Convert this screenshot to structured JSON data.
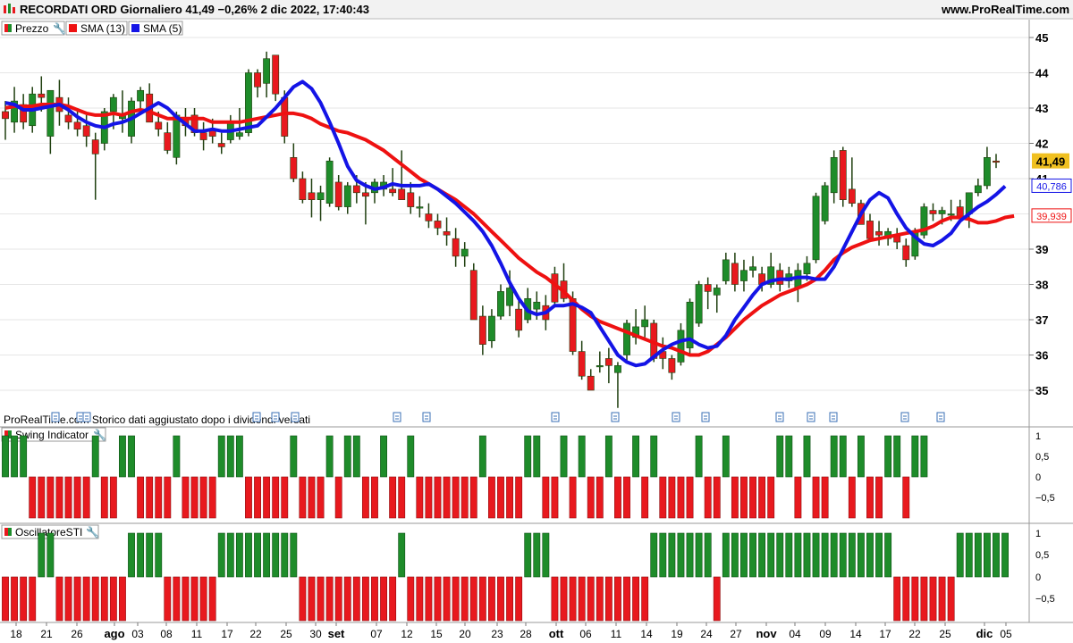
{
  "header": {
    "title": "RECORDATI ORD Giornaliero 41,49 −0,26% 2 dic 2022, 17:40:43",
    "brand": "www.ProRealTime.com"
  },
  "legend": {
    "price": "Prezzo",
    "sma13": "SMA (13)",
    "sma5": "SMA (5)"
  },
  "panels": {
    "swing_title": "Swing Indicator",
    "sti_title": "OscillatoreSTI"
  },
  "note": "ProRealTime.com  Storico dati aggiustato dopo i dividendi versati",
  "colors": {
    "up": "#1e8c2a",
    "down": "#e8191e",
    "sma13": "#ee1111",
    "sma5": "#1414e6",
    "wick": "#1f3f0f",
    "last_price_bg": "#f0c020"
  },
  "price_axis": {
    "ticks": [
      "45",
      "44",
      "43",
      "42",
      "41",
      "39",
      "38",
      "37",
      "36",
      "35"
    ],
    "last_price": "41,49",
    "sma5_value": "40,786",
    "sma13_value": "39,939"
  },
  "swing_axis": {
    "ticks": [
      "1",
      "0,5",
      "0",
      "−0,5"
    ]
  },
  "sti_axis": {
    "ticks": [
      "1",
      "0,5",
      "0",
      "−0,5"
    ]
  },
  "x_axis": {
    "labels": [
      "18",
      "21",
      "26",
      "ago",
      "03",
      "08",
      "11",
      "17",
      "22",
      "25",
      "30",
      "set",
      "07",
      "12",
      "15",
      "20",
      "23",
      "28",
      "ott",
      "06",
      "11",
      "14",
      "19",
      "24",
      "27",
      "nov",
      "04",
      "09",
      "14",
      "17",
      "22",
      "25",
      "dic",
      "05"
    ]
  },
  "chart_data": {
    "type": "candlestick",
    "ylim": [
      34.7,
      45.1
    ],
    "candles": [
      {
        "o": 42.9,
        "h": 43.2,
        "l": 42.1,
        "c": 42.7
      },
      {
        "o": 42.6,
        "h": 43.6,
        "l": 42.3,
        "c": 43.2
      },
      {
        "o": 43.1,
        "h": 43.4,
        "l": 42.4,
        "c": 42.6
      },
      {
        "o": 42.5,
        "h": 43.6,
        "l": 42.3,
        "c": 43.4
      },
      {
        "o": 43.4,
        "h": 43.9,
        "l": 42.9,
        "c": 43.3
      },
      {
        "o": 42.2,
        "h": 43.5,
        "l": 41.7,
        "c": 43.5
      },
      {
        "o": 43.3,
        "h": 43.8,
        "l": 42.5,
        "c": 42.9
      },
      {
        "o": 42.8,
        "h": 43.3,
        "l": 42.4,
        "c": 42.6
      },
      {
        "o": 42.6,
        "h": 42.9,
        "l": 42.2,
        "c": 42.4
      },
      {
        "o": 42.5,
        "h": 42.8,
        "l": 41.9,
        "c": 42.2
      },
      {
        "o": 42.1,
        "h": 42.3,
        "l": 40.4,
        "c": 41.7
      },
      {
        "o": 42.0,
        "h": 43.0,
        "l": 41.8,
        "c": 42.9
      },
      {
        "o": 42.9,
        "h": 43.4,
        "l": 42.4,
        "c": 43.3
      },
      {
        "o": 42.7,
        "h": 43.5,
        "l": 42.3,
        "c": 42.8
      },
      {
        "o": 42.2,
        "h": 43.3,
        "l": 42.0,
        "c": 43.2
      },
      {
        "o": 43.2,
        "h": 43.6,
        "l": 42.8,
        "c": 43.5
      },
      {
        "o": 43.4,
        "h": 43.7,
        "l": 42.6,
        "c": 42.6
      },
      {
        "o": 42.6,
        "h": 42.9,
        "l": 42.2,
        "c": 42.4
      },
      {
        "o": 42.3,
        "h": 42.6,
        "l": 41.7,
        "c": 41.8
      },
      {
        "o": 41.6,
        "h": 42.9,
        "l": 41.4,
        "c": 42.8
      },
      {
        "o": 42.7,
        "h": 43.0,
        "l": 42.2,
        "c": 42.5
      },
      {
        "o": 42.8,
        "h": 43.0,
        "l": 42.2,
        "c": 42.3
      },
      {
        "o": 42.3,
        "h": 42.6,
        "l": 41.8,
        "c": 42.1
      },
      {
        "o": 42.4,
        "h": 42.7,
        "l": 42.0,
        "c": 42.2
      },
      {
        "o": 42.0,
        "h": 42.3,
        "l": 41.7,
        "c": 41.9
      },
      {
        "o": 42.1,
        "h": 42.8,
        "l": 42.0,
        "c": 42.6
      },
      {
        "o": 42.2,
        "h": 43.0,
        "l": 42.1,
        "c": 42.3
      },
      {
        "o": 42.3,
        "h": 44.1,
        "l": 42.2,
        "c": 44.0
      },
      {
        "o": 44.0,
        "h": 44.1,
        "l": 43.3,
        "c": 43.6
      },
      {
        "o": 43.7,
        "h": 44.6,
        "l": 43.3,
        "c": 44.4
      },
      {
        "o": 44.5,
        "h": 44.5,
        "l": 43.2,
        "c": 43.4
      },
      {
        "o": 43.3,
        "h": 43.5,
        "l": 42.0,
        "c": 42.2
      },
      {
        "o": 41.6,
        "h": 42.0,
        "l": 40.9,
        "c": 41.0
      },
      {
        "o": 41.0,
        "h": 41.2,
        "l": 40.3,
        "c": 40.4
      },
      {
        "o": 40.6,
        "h": 41.0,
        "l": 39.9,
        "c": 40.4
      },
      {
        "o": 40.4,
        "h": 40.8,
        "l": 39.8,
        "c": 40.6
      },
      {
        "o": 40.3,
        "h": 41.6,
        "l": 40.2,
        "c": 41.5
      },
      {
        "o": 40.9,
        "h": 41.1,
        "l": 40.1,
        "c": 40.2
      },
      {
        "o": 40.2,
        "h": 40.9,
        "l": 40.0,
        "c": 40.8
      },
      {
        "o": 40.8,
        "h": 41.1,
        "l": 40.3,
        "c": 40.6
      },
      {
        "o": 40.6,
        "h": 40.9,
        "l": 39.7,
        "c": 40.5
      },
      {
        "o": 40.6,
        "h": 41.0,
        "l": 40.3,
        "c": 40.9
      },
      {
        "o": 40.7,
        "h": 41.1,
        "l": 40.5,
        "c": 40.9
      },
      {
        "o": 40.7,
        "h": 41.3,
        "l": 40.5,
        "c": 40.6
      },
      {
        "o": 40.7,
        "h": 41.8,
        "l": 40.4,
        "c": 40.4
      },
      {
        "o": 40.6,
        "h": 40.9,
        "l": 40.0,
        "c": 40.2
      },
      {
        "o": 40.2,
        "h": 40.5,
        "l": 39.9,
        "c": 40.2
      },
      {
        "o": 40.0,
        "h": 40.3,
        "l": 39.6,
        "c": 39.8
      },
      {
        "o": 39.8,
        "h": 40.0,
        "l": 39.4,
        "c": 39.6
      },
      {
        "o": 39.5,
        "h": 39.9,
        "l": 39.1,
        "c": 39.4
      },
      {
        "o": 39.3,
        "h": 39.6,
        "l": 38.5,
        "c": 38.8
      },
      {
        "o": 38.8,
        "h": 39.2,
        "l": 38.5,
        "c": 39.0
      },
      {
        "o": 38.4,
        "h": 38.6,
        "l": 37.0,
        "c": 37.0
      },
      {
        "o": 37.1,
        "h": 37.4,
        "l": 36.0,
        "c": 36.3
      },
      {
        "o": 36.4,
        "h": 37.3,
        "l": 36.2,
        "c": 37.1
      },
      {
        "o": 37.1,
        "h": 38.0,
        "l": 37.0,
        "c": 37.8
      },
      {
        "o": 37.4,
        "h": 38.4,
        "l": 37.1,
        "c": 37.9
      },
      {
        "o": 37.3,
        "h": 37.6,
        "l": 36.5,
        "c": 36.7
      },
      {
        "o": 37.0,
        "h": 37.9,
        "l": 36.9,
        "c": 37.6
      },
      {
        "o": 37.3,
        "h": 37.8,
        "l": 37.0,
        "c": 37.5
      },
      {
        "o": 37.4,
        "h": 37.7,
        "l": 36.7,
        "c": 37.0
      },
      {
        "o": 38.3,
        "h": 38.5,
        "l": 37.4,
        "c": 37.5
      },
      {
        "o": 38.1,
        "h": 38.6,
        "l": 37.5,
        "c": 37.6
      },
      {
        "o": 37.6,
        "h": 37.8,
        "l": 36.0,
        "c": 36.1
      },
      {
        "o": 36.1,
        "h": 36.4,
        "l": 35.3,
        "c": 35.4
      },
      {
        "o": 35.4,
        "h": 35.6,
        "l": 35.1,
        "c": 35.0
      },
      {
        "o": 35.7,
        "h": 36.1,
        "l": 35.5,
        "c": 35.7
      },
      {
        "o": 35.9,
        "h": 36.2,
        "l": 35.2,
        "c": 35.7
      },
      {
        "o": 35.5,
        "h": 35.8,
        "l": 34.5,
        "c": 35.7
      },
      {
        "o": 36.0,
        "h": 37.0,
        "l": 35.8,
        "c": 36.9
      },
      {
        "o": 36.5,
        "h": 37.3,
        "l": 36.3,
        "c": 36.8
      },
      {
        "o": 36.8,
        "h": 37.4,
        "l": 36.5,
        "c": 37.0
      },
      {
        "o": 36.9,
        "h": 37.0,
        "l": 35.8,
        "c": 35.9
      },
      {
        "o": 36.1,
        "h": 36.5,
        "l": 35.6,
        "c": 35.9
      },
      {
        "o": 35.9,
        "h": 36.0,
        "l": 35.3,
        "c": 35.5
      },
      {
        "o": 35.8,
        "h": 36.9,
        "l": 35.7,
        "c": 36.7
      },
      {
        "o": 36.2,
        "h": 37.6,
        "l": 36.0,
        "c": 37.5
      },
      {
        "o": 36.9,
        "h": 38.1,
        "l": 36.8,
        "c": 38.0
      },
      {
        "o": 38.0,
        "h": 38.2,
        "l": 37.3,
        "c": 37.8
      },
      {
        "o": 37.7,
        "h": 38.0,
        "l": 37.2,
        "c": 37.9
      },
      {
        "o": 38.1,
        "h": 38.9,
        "l": 38.0,
        "c": 38.7
      },
      {
        "o": 38.6,
        "h": 38.9,
        "l": 37.8,
        "c": 38.0
      },
      {
        "o": 38.1,
        "h": 38.7,
        "l": 37.8,
        "c": 38.4
      },
      {
        "o": 38.4,
        "h": 38.8,
        "l": 38.2,
        "c": 38.5
      },
      {
        "o": 38.3,
        "h": 38.5,
        "l": 37.8,
        "c": 38.0
      },
      {
        "o": 38.0,
        "h": 38.9,
        "l": 37.9,
        "c": 38.5
      },
      {
        "o": 38.4,
        "h": 38.6,
        "l": 37.8,
        "c": 38.0
      },
      {
        "o": 38.1,
        "h": 38.5,
        "l": 37.9,
        "c": 38.3
      },
      {
        "o": 37.9,
        "h": 38.6,
        "l": 37.5,
        "c": 38.4
      },
      {
        "o": 38.3,
        "h": 38.8,
        "l": 38.1,
        "c": 38.6
      },
      {
        "o": 38.7,
        "h": 40.6,
        "l": 38.6,
        "c": 40.5
      },
      {
        "o": 39.8,
        "h": 40.9,
        "l": 39.7,
        "c": 40.8
      },
      {
        "o": 40.6,
        "h": 41.8,
        "l": 40.3,
        "c": 41.6
      },
      {
        "o": 41.8,
        "h": 41.9,
        "l": 40.2,
        "c": 40.4
      },
      {
        "o": 40.7,
        "h": 41.6,
        "l": 40.2,
        "c": 40.3
      },
      {
        "o": 40.3,
        "h": 40.4,
        "l": 39.7,
        "c": 39.7
      },
      {
        "o": 39.8,
        "h": 40.0,
        "l": 39.2,
        "c": 39.3
      },
      {
        "o": 39.5,
        "h": 39.8,
        "l": 39.1,
        "c": 39.4
      },
      {
        "o": 39.3,
        "h": 39.6,
        "l": 39.1,
        "c": 39.5
      },
      {
        "o": 39.4,
        "h": 39.6,
        "l": 39.0,
        "c": 39.2
      },
      {
        "o": 39.1,
        "h": 39.3,
        "l": 38.5,
        "c": 38.7
      },
      {
        "o": 38.8,
        "h": 39.6,
        "l": 38.7,
        "c": 39.5
      },
      {
        "o": 39.4,
        "h": 40.3,
        "l": 39.3,
        "c": 40.2
      },
      {
        "o": 40.1,
        "h": 40.3,
        "l": 39.8,
        "c": 40.0
      },
      {
        "o": 40.0,
        "h": 40.2,
        "l": 39.7,
        "c": 40.1
      },
      {
        "o": 40.0,
        "h": 40.4,
        "l": 39.8,
        "c": 40.0
      },
      {
        "o": 40.2,
        "h": 40.4,
        "l": 39.8,
        "c": 39.9
      },
      {
        "o": 40.0,
        "h": 40.6,
        "l": 39.6,
        "c": 40.6
      },
      {
        "o": 40.6,
        "h": 41.0,
        "l": 40.5,
        "c": 40.8
      },
      {
        "o": 40.8,
        "h": 41.9,
        "l": 40.7,
        "c": 41.6
      },
      {
        "o": 41.5,
        "h": 41.7,
        "l": 41.3,
        "c": 41.49
      }
    ],
    "sma13": [
      43.0,
      43.05,
      43.05,
      43.05,
      43.1,
      43.1,
      43.1,
      43.05,
      42.95,
      42.85,
      42.8,
      42.8,
      42.85,
      42.8,
      42.9,
      42.95,
      42.9,
      42.8,
      42.7,
      42.7,
      42.7,
      42.7,
      42.7,
      42.6,
      42.6,
      42.6,
      42.6,
      42.65,
      42.7,
      42.75,
      42.8,
      42.85,
      42.85,
      42.8,
      42.7,
      42.55,
      42.45,
      42.35,
      42.3,
      42.2,
      42.1,
      41.95,
      41.8,
      41.6,
      41.4,
      41.2,
      41.0,
      40.85,
      40.7,
      40.55,
      40.4,
      40.2,
      40.0,
      39.75,
      39.5,
      39.25,
      39.0,
      38.75,
      38.55,
      38.35,
      38.2,
      38.0,
      37.8,
      37.55,
      37.3,
      37.1,
      36.95,
      36.85,
      36.75,
      36.65,
      36.55,
      36.45,
      36.35,
      36.25,
      36.2,
      36.1,
      36.0,
      36.0,
      36.1,
      36.3,
      36.5,
      36.75,
      37.0,
      37.2,
      37.4,
      37.55,
      37.7,
      37.8,
      37.9,
      38.0,
      38.15,
      38.4,
      38.7,
      38.9,
      39.05,
      39.15,
      39.25,
      39.3,
      39.35,
      39.4,
      39.45,
      39.5,
      39.55,
      39.65,
      39.8,
      39.9,
      39.9,
      39.85,
      39.75,
      39.75,
      39.8,
      39.9,
      39.94
    ],
    "sma5": [
      43.15,
      43.1,
      42.95,
      42.95,
      43.0,
      43.05,
      43.1,
      42.95,
      42.75,
      42.6,
      42.5,
      42.45,
      42.55,
      42.6,
      42.7,
      42.85,
      43.0,
      43.15,
      43.0,
      42.75,
      42.55,
      42.35,
      42.35,
      42.4,
      42.35,
      42.35,
      42.4,
      42.45,
      42.5,
      42.75,
      43.0,
      43.3,
      43.6,
      43.75,
      43.55,
      43.15,
      42.6,
      42.0,
      41.35,
      40.95,
      40.8,
      40.7,
      40.75,
      40.85,
      40.8,
      40.8,
      40.8,
      40.85,
      40.7,
      40.5,
      40.3,
      40.05,
      39.8,
      39.5,
      39.1,
      38.6,
      38.05,
      37.6,
      37.25,
      37.15,
      37.2,
      37.4,
      37.4,
      37.45,
      37.35,
      37.2,
      36.8,
      36.4,
      36.0,
      35.8,
      35.7,
      35.75,
      35.95,
      36.15,
      36.3,
      36.4,
      36.45,
      36.3,
      36.2,
      36.25,
      36.55,
      37.0,
      37.35,
      37.7,
      38.0,
      38.1,
      38.15,
      38.15,
      38.2,
      38.2,
      38.15,
      38.15,
      38.5,
      39.0,
      39.5,
      40.0,
      40.4,
      40.6,
      40.45,
      40.0,
      39.6,
      39.35,
      39.15,
      39.1,
      39.25,
      39.45,
      39.8,
      40.0,
      40.2,
      40.35,
      40.55,
      40.786
    ],
    "swing": [
      1,
      1,
      1,
      0,
      0,
      0,
      0,
      0,
      0,
      0,
      1,
      0,
      0,
      1,
      1,
      0,
      0,
      0,
      0,
      1,
      0,
      0,
      0,
      0,
      1,
      1,
      1,
      0,
      0,
      0,
      0,
      0,
      1,
      0,
      0,
      0,
      1,
      0,
      1,
      1,
      0,
      0,
      1,
      0,
      0,
      1,
      0,
      0,
      0,
      0,
      0,
      0,
      0,
      1,
      0,
      0,
      0,
      0,
      1,
      1,
      0,
      0,
      1,
      0,
      1,
      0,
      0,
      1,
      0,
      0,
      1,
      0,
      1,
      0,
      0,
      0,
      0,
      1,
      0,
      0,
      1,
      0,
      0,
      0,
      0,
      0,
      1,
      1,
      0,
      1,
      0,
      0,
      1,
      1,
      0,
      1,
      0,
      0,
      1,
      1,
      0,
      1,
      1
    ],
    "sti": [
      0,
      0,
      0,
      0,
      1,
      1,
      0,
      0,
      0,
      0,
      0,
      0,
      0,
      0,
      1,
      1,
      1,
      1,
      0,
      0,
      0,
      0,
      0,
      0,
      1,
      1,
      1,
      1,
      1,
      1,
      1,
      1,
      1,
      0,
      0,
      0,
      0,
      0,
      0,
      0,
      0,
      0,
      0,
      0,
      1,
      0,
      0,
      0,
      0,
      0,
      0,
      0,
      0,
      0,
      0,
      0,
      0,
      0,
      1,
      1,
      1,
      0,
      0,
      0,
      0,
      0,
      0,
      0,
      0,
      0,
      0,
      0,
      1,
      1,
      1,
      1,
      1,
      1,
      1,
      0,
      1,
      1,
      1,
      1,
      1,
      1,
      1,
      1,
      1,
      1,
      1,
      1,
      1,
      1,
      1,
      1,
      1,
      1,
      1,
      0,
      0,
      0,
      0,
      0,
      0,
      0,
      1,
      1,
      1,
      1,
      1,
      1
    ]
  }
}
